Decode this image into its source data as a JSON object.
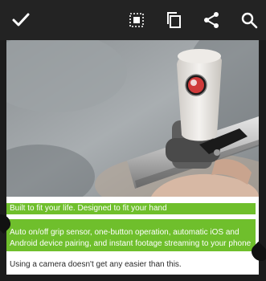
{
  "toolbar": {
    "done_icon": "checkmark-icon",
    "select_all_icon": "select-all-icon",
    "copy_icon": "copy-icon",
    "share_icon": "share-icon",
    "search_icon": "search-icon"
  },
  "document": {
    "selected_lines": [
      "Built to fit your life. Designed to fit your hand",
      "Auto on/off grip sensor, one-button operation, automatic iOS and",
      "Android device pairing, and instant footage streaming to your phone"
    ],
    "body_line": "Using a camera doesn't get any easier than this."
  },
  "colors": {
    "toolbar_bg": "#232323",
    "selection": "#6fbf2c",
    "icon": "#ffffff"
  }
}
